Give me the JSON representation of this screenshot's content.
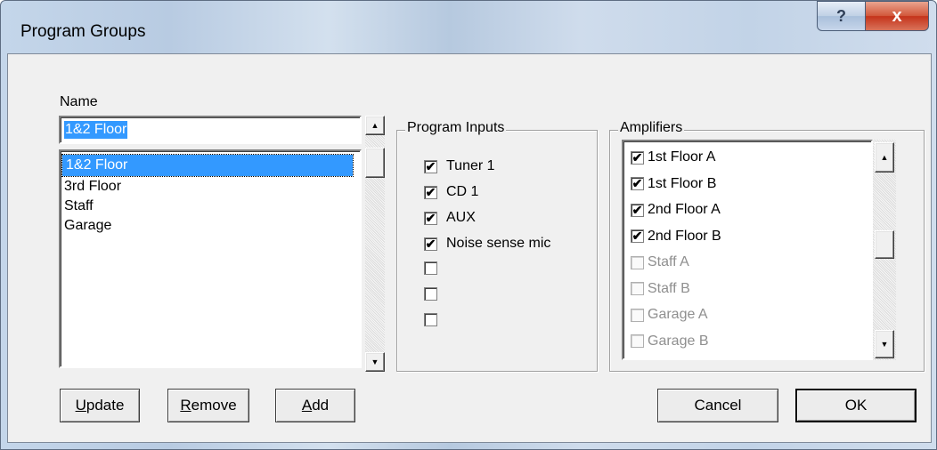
{
  "window": {
    "title": "Program Groups",
    "help_glyph": "?",
    "close_glyph": "x"
  },
  "name_section": {
    "label": "Name",
    "input_value": "1&2 Floor",
    "items": [
      "1&2 Floor",
      "3rd Floor",
      "Staff",
      "Garage"
    ],
    "selected_index": 0
  },
  "program_inputs": {
    "title": "Program Inputs",
    "items": [
      {
        "label": "Tuner 1",
        "checked": true
      },
      {
        "label": "CD 1",
        "checked": true
      },
      {
        "label": "AUX",
        "checked": true
      },
      {
        "label": "Noise sense mic",
        "checked": true
      },
      {
        "label": "",
        "checked": false
      },
      {
        "label": "",
        "checked": false
      },
      {
        "label": "",
        "checked": false
      }
    ]
  },
  "amplifiers": {
    "title": "Amplifiers",
    "items": [
      {
        "label": "1st Floor A",
        "checked": true,
        "enabled": true
      },
      {
        "label": "1st Floor B",
        "checked": true,
        "enabled": true
      },
      {
        "label": "2nd Floor A",
        "checked": true,
        "enabled": true
      },
      {
        "label": "2nd Floor B",
        "checked": true,
        "enabled": true
      },
      {
        "label": "Staff A",
        "checked": false,
        "enabled": false
      },
      {
        "label": "Staff B",
        "checked": false,
        "enabled": false
      },
      {
        "label": "Garage A",
        "checked": false,
        "enabled": false
      },
      {
        "label": "Garage B",
        "checked": false,
        "enabled": false
      }
    ]
  },
  "buttons": {
    "update": {
      "accel": "U",
      "rest": "pdate"
    },
    "remove": {
      "accel": "R",
      "rest": "emove"
    },
    "add": {
      "accel": "A",
      "rest": "dd"
    },
    "cancel": "Cancel",
    "ok": "OK"
  },
  "glyphs": {
    "check": "✔",
    "arrow_up": "▲",
    "arrow_down": "▼"
  }
}
